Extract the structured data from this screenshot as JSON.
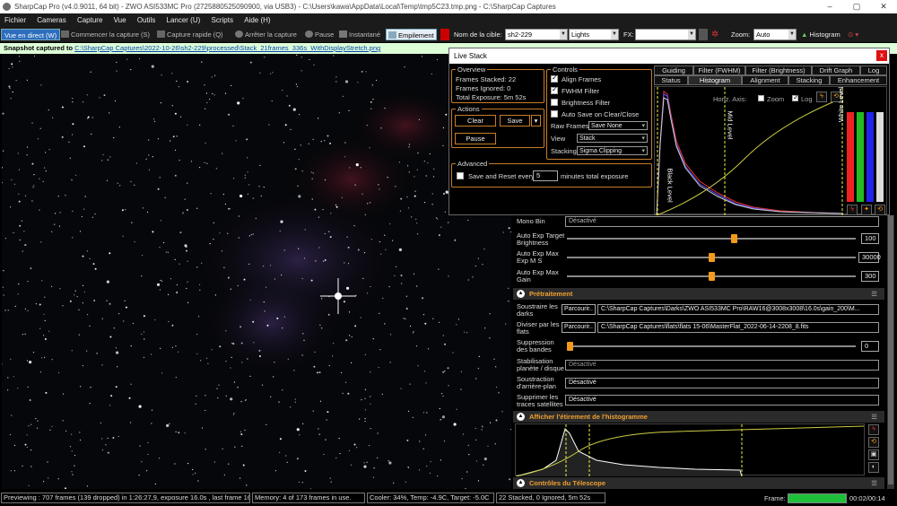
{
  "titlebar": {
    "text": "SharpCap Pro (v4.0.9011, 64 bit) - ZWO ASI533MC Pro (2725880525090900, via USB3) - C:\\Users\\kawa\\AppData\\Local\\Temp\\tmp5C23.tmp.png - C:\\SharpCap Captures",
    "minimize": "–",
    "maximize": "▢",
    "close": "✕"
  },
  "menu": [
    "Fichier",
    "Cameras",
    "Capture",
    "Vue",
    "Outils",
    "Lancer (U)",
    "Scripts",
    "Aide (H)"
  ],
  "toolbar": {
    "live_view": "Vue en direct (W)",
    "start_capture": "Commencer la capture (S)",
    "quick_capture": "Capture rapide (Q)",
    "stop_capture": "Arrêter la capture",
    "pause": "Pause",
    "snapshot": "Instantané",
    "stacking": "Empilement",
    "target_label": "Nom de la cible:",
    "target_value": "sh2-229",
    "frame_type": "Lights",
    "fx_label": "FX:",
    "fx_value": "",
    "zoom_label": "Zoom:",
    "zoom_value": "Auto",
    "histogram": "Histogram"
  },
  "snapshot_bar": {
    "prefix": "Snapshot captured to ",
    "path": "C:\\SharpCap Captures\\2022-10-26\\sh2-229\\processed\\Stack_21frames_336s_WithDisplayStretch.png"
  },
  "live_stack": {
    "title": "Live Stack",
    "close": "x",
    "overview": {
      "title": "Overview",
      "frames_stacked": "Frames Stacked: 22",
      "frames_ignored": "Frames Ignored:  0",
      "total_exposure": "Total Exposure:   5m 52s"
    },
    "actions": {
      "title": "Actions",
      "clear": "Clear",
      "save": "Save",
      "pause": "Pause"
    },
    "advanced": {
      "title": "Advanced",
      "save_reset_label": "Save and Reset every",
      "save_reset_value": "5",
      "save_reset_suffix": "minutes total exposure"
    },
    "controls": {
      "title": "Controls",
      "align_frames": "Align Frames",
      "fwhm_filter": "FWHM Filter",
      "brightness_filter": "Brightness Filter",
      "auto_save": "Auto Save on Clear/Close",
      "raw_frames_label": "Raw Frames",
      "raw_frames_value": "Save None",
      "view_label": "View",
      "view_value": "Stack",
      "stacking_label": "Stacking",
      "stacking_value": "Sigma Clipping"
    },
    "tabs_row1": [
      "Guiding",
      "Filter (FWHM)",
      "Filter (Brightness)",
      "Drift Graph",
      "Log"
    ],
    "tabs_row2": [
      "Status",
      "Histogram",
      "Alignment",
      "Stacking",
      "Enhancement"
    ],
    "hist": {
      "horiz_axis": "Horiz. Axis:",
      "zoom": "Zoom",
      "log": "Log",
      "black_level": "Black Level",
      "mid_level": "Mid Level",
      "white_level": "White Level"
    }
  },
  "right_panel": {
    "mono_bin_label": "Mono Bin",
    "mono_bin_value": "Désactivé",
    "auto_exp_target_label": "Auto Exp Target Brightness",
    "auto_exp_target_value": "100",
    "auto_exp_target_level": 0.58,
    "auto_exp_max_exp_label": "Auto Exp Max Exp M S",
    "auto_exp_max_exp_value": "30000",
    "auto_exp_max_exp_level": 0.5,
    "auto_exp_max_gain_label": "Auto Exp Max Gain",
    "auto_exp_max_gain_value": "300",
    "auto_exp_max_gain_level": 0.5,
    "pretraitement_title": "Prétraitement",
    "darks_label": "Soustraire les darks",
    "darks_button": "Parcourir..",
    "darks_path": "C:\\SharpCap Captures\\Darks\\ZWO ASI533MC Pro\\RAW16@3008x3008\\16.0s\\gain_200\\M...",
    "flats_label": "Diviser par les flats",
    "flats_button": "Parcourir..",
    "flats_path": "C:\\SharpCap Captures\\flats\\flats 15-06\\MasterFlat_2022-06-14-2208_8.fits",
    "bands_label": "Suppression des bandes",
    "bands_value": "0",
    "bands_level": 0,
    "stab_label": "Stabilisation planète / disque",
    "stab_value": "Désactivé",
    "bg_label": "Soustraction d'arrière-plan",
    "bg_value": "Désactivé",
    "sat_label": "Supprimer les traces satellites",
    "sat_value": "Désactivé",
    "histo_title": "Afficher l'étirement de l'histogramme",
    "telescope_title": "Contrôles du Télescope"
  },
  "statusbar": {
    "previewing": "Previewing : 707 frames (139 dropped) in 1:26:27,9, exposure 16.0s , last frame 16.",
    "memory": "Memory: 4 of 173 frames in use.",
    "cooler": "Cooler: 34%, Temp: -4.9C, Target: -5.0C",
    "stacked": "22 Stacked, 0 Ignored, 5m 52s",
    "frame_label": "Frame:",
    "frame_progress": 1.0,
    "time": "00:02/00:14"
  }
}
